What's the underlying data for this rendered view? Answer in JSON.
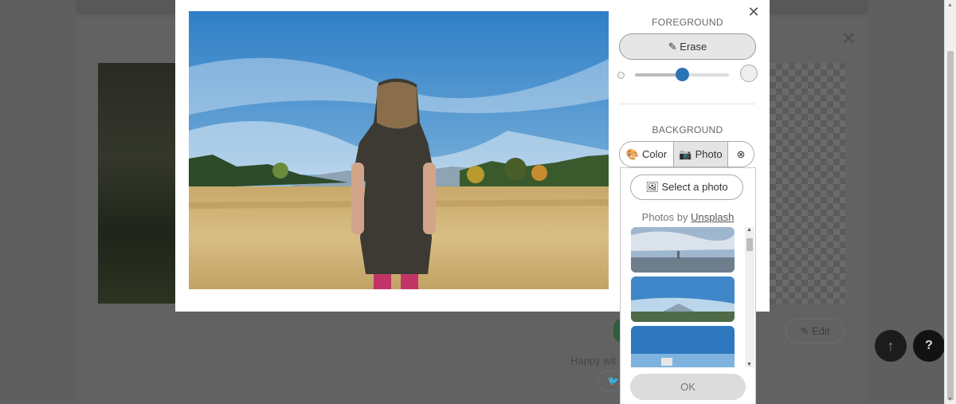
{
  "background_page": {
    "edit_label": "✎ Edit",
    "happy_text": "Happy wit",
    "share_icon": "twitter-icon",
    "scroll_top_glyph": "↑",
    "help_glyph": "?",
    "close_glyph": "✕"
  },
  "modal": {
    "close_glyph": "✕",
    "foreground": {
      "title": "FOREGROUND",
      "erase_label": "Erase",
      "brush_size_fraction": 0.5
    },
    "background": {
      "title": "BACKGROUND",
      "options": [
        {
          "label": "Color",
          "icon": "palette-icon"
        },
        {
          "label": "Photo",
          "icon": "camera-icon",
          "selected": true
        },
        {
          "label": "",
          "icon": "close-circle-icon"
        }
      ]
    },
    "photo_panel": {
      "select_label": "Select a photo",
      "photos_by_prefix": "Photos by",
      "photos_by_link": "Unsplash",
      "ok_label": "OK"
    }
  },
  "colors": {
    "accent": "#2b73b5",
    "overlay": "#5f5f5f"
  }
}
